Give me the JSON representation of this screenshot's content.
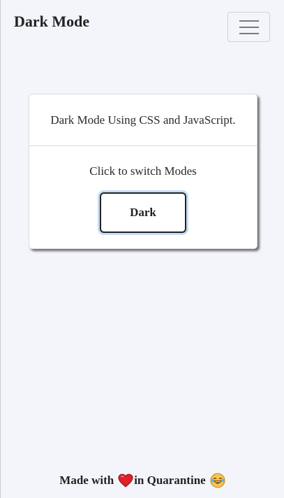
{
  "navbar": {
    "brand": "Dark Mode",
    "menu_icon": "hamburger-menu-icon"
  },
  "card": {
    "header": "Dark Mode Using CSS and JavaScript.",
    "instruction": "Click to switch Modes",
    "button_label": "Dark"
  },
  "footer": {
    "prefix": "Made with",
    "heart_icon": "red-heart-icon",
    "suffix": "in Quarantine",
    "emoji_icon": "tears-of-joy-emoji-icon"
  },
  "colors": {
    "background": "#f4f5fa",
    "card_background": "#ffffff",
    "focus_ring": "#c6dcf7",
    "heart": "#e0202a"
  }
}
